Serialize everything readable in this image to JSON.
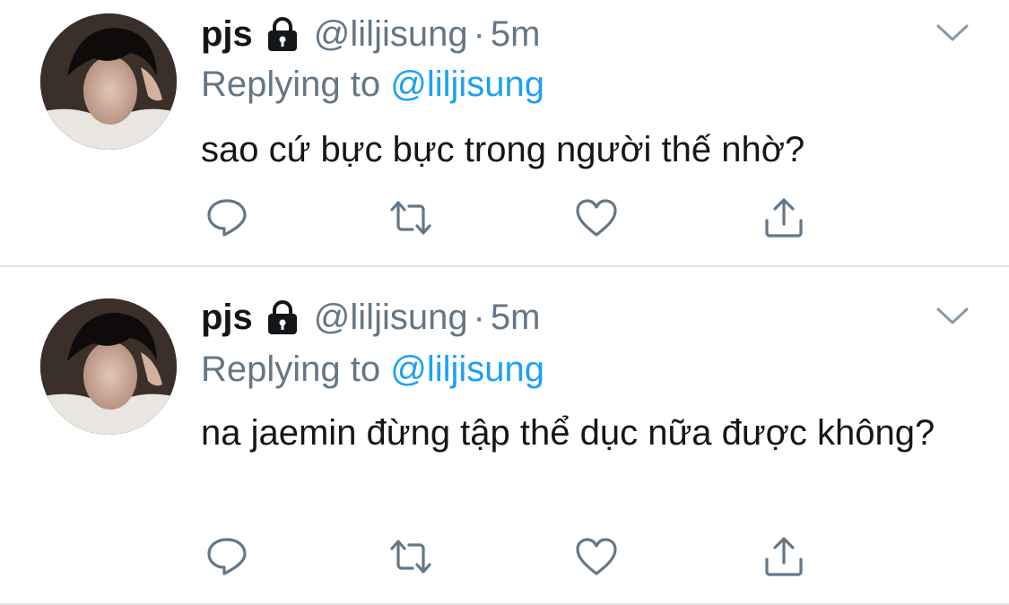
{
  "colors": {
    "text": "#14171a",
    "secondary": "#657786",
    "link": "#1da1f2",
    "divider": "#dfe3e6"
  },
  "tweets": [
    {
      "display_name": "pjs",
      "handle": "@liljisung",
      "separator": "·",
      "time": "5m",
      "replying_label": "Replying to",
      "replying_to": "@liljisung",
      "text": "sao cứ bực bực trong người thế nhờ?",
      "protected_icon": "lock-icon",
      "actions": [
        "reply-icon",
        "retweet-icon",
        "like-icon",
        "share-icon"
      ]
    },
    {
      "display_name": "pjs",
      "handle": "@liljisung",
      "separator": "·",
      "time": "5m",
      "replying_label": "Replying to",
      "replying_to": "@liljisung",
      "text": "na jaemin đừng tập thể dục nữa được không?",
      "protected_icon": "lock-icon",
      "actions": [
        "reply-icon",
        "retweet-icon",
        "like-icon",
        "share-icon"
      ]
    }
  ]
}
